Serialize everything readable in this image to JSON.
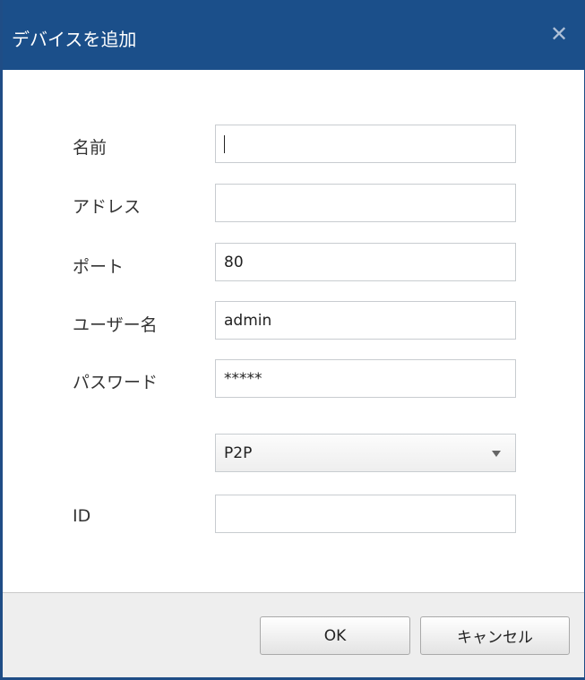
{
  "dialog": {
    "title": "デバイスを追加",
    "close_icon": "close-icon"
  },
  "form": {
    "name_label": "名前",
    "name_value": "",
    "address_label": "アドレス",
    "address_value": "",
    "port_label": "ポート",
    "port_value": "80",
    "username_label": "ユーザー名",
    "username_value": "admin",
    "password_label": "パスワード",
    "password_value": "*****",
    "mode_selected": "P2P",
    "id_label": "ID",
    "id_value": ""
  },
  "buttons": {
    "ok_label": "OK",
    "cancel_label": "キャンセル"
  },
  "colors": {
    "titlebar": "#1b4f8a",
    "footer": "#eeeeee"
  }
}
